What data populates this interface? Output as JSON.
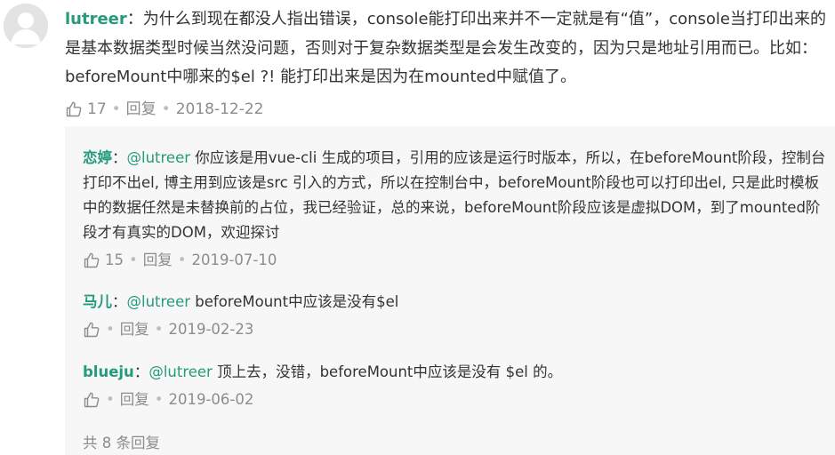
{
  "main_comment": {
    "author": "lutreer",
    "colon": "：",
    "text": "为什么到现在都没人指出错误，console能打印出来并不一定就是有“值”，console当打印出来的是基本数据类型时候当然没问题，否则对于复杂数据类型是会发生改变的，因为只是地址引用而已。比如：beforeMount中哪来的$el ?! 能打印出来是因为在mounted中赋值了。",
    "likes": "17",
    "reply_label": "回复",
    "date": "2018-12-22",
    "separator": "•"
  },
  "replies": [
    {
      "author": "恋婷",
      "colon": "：",
      "mention": "@lutreer",
      "text": " 你应该是用vue-cli 生成的项目，引用的应该是运行时版本，所以，在beforeMount阶段，控制台打印不出el, 博主用到应该是src 引入的方式，所以在控制台中，beforeMount阶段也可以打印出el, 只是此时模板中的数据任然是未替换前的占位，我已经验证，总的来说，beforeMount阶段应该是虚拟DOM，到了mounted阶段才有真实的DOM，欢迎探讨",
      "likes": "15",
      "reply_label": "回复",
      "date": "2019-07-10"
    },
    {
      "author": "马儿",
      "colon": "：",
      "mention": "@lutreer",
      "text": " beforeMount中应该是没有$el",
      "likes": "",
      "reply_label": "回复",
      "date": "2019-02-23"
    },
    {
      "author": "blueju",
      "colon": "：",
      "mention": "@lutreer",
      "text": " 顶上去，没错，beforeMount中应该是没有 $el 的。",
      "likes": "",
      "reply_label": "回复",
      "date": "2019-06-02"
    }
  ],
  "total_replies": "共 8 条回复",
  "colors": {
    "accent": "#259b7c",
    "meta": "#8c8c8c",
    "text": "#333333",
    "reply_bg": "#f7f7f7"
  },
  "icons": {
    "avatar": "default-user-avatar",
    "like": "thumbs-up-icon"
  }
}
